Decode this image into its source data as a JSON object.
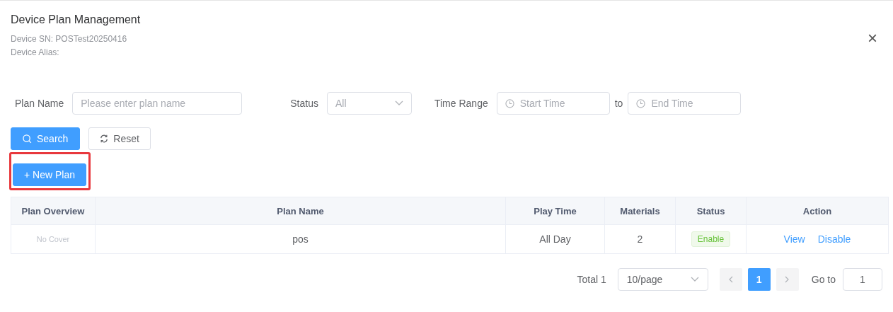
{
  "dialog": {
    "title": "Device Plan Management",
    "subtitle_lines": [
      "Device SN: POSTest20250416",
      "Device Alias:"
    ],
    "close": "×"
  },
  "filters": [
    {
      "kind": "text",
      "label": "Plan Name",
      "placeholder": "Please enter plan name"
    },
    {
      "kind": "select",
      "label": "Status",
      "value": "All"
    },
    {
      "kind": "range",
      "label": "Time Range",
      "start_placeholder": "Start Time",
      "separator": "to",
      "end_placeholder": "End Time"
    }
  ],
  "buttons": [
    {
      "kind": "primary",
      "label": "Search"
    },
    {
      "kind": "default",
      "label": "Reset"
    }
  ],
  "new_plan": {
    "label": "+ New Plan",
    "highlighted": true
  },
  "table": {
    "columns": [
      "Plan Overview",
      "Plan Name",
      "Play Time",
      "Materials",
      "Status",
      "Action"
    ],
    "rows": [
      {
        "cover": "No Cover",
        "name": "pos",
        "play_time": "All Day",
        "materials": "2",
        "status": {
          "label": "Enable",
          "kind": "success"
        },
        "actions": [
          "View",
          "Disable"
        ]
      }
    ]
  },
  "pagination": {
    "total": "Total 1",
    "page_size": "10/page",
    "pages": [
      {
        "label": "1",
        "selected": true
      }
    ],
    "goto_label": "Go to",
    "goto_value": "1"
  }
}
